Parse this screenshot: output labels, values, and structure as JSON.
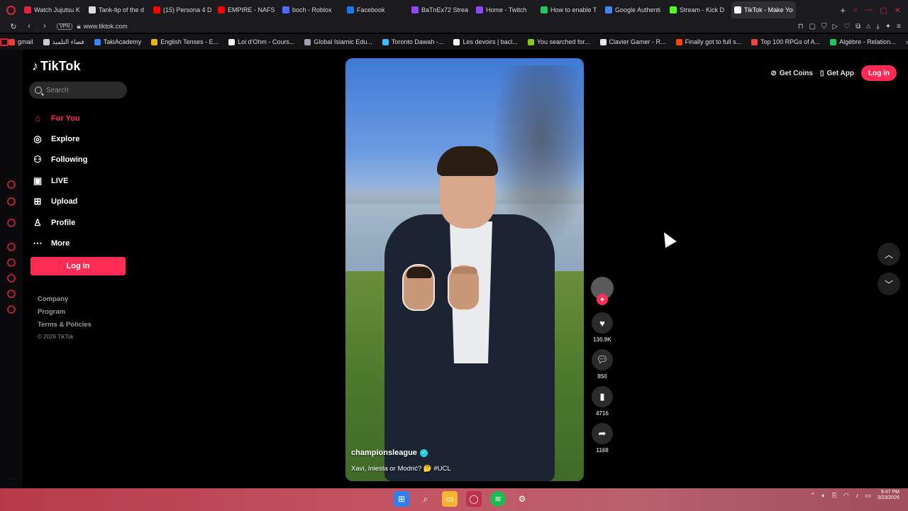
{
  "browser": {
    "tabs": [
      {
        "label": "Watch Jujutsu K",
        "color": "#e0223c"
      },
      {
        "label": "Tank-tip of the d",
        "color": "#dddddd"
      },
      {
        "label": "(15) Persona 4 D",
        "color": "#ff0000"
      },
      {
        "label": "EMPIRE - NAFS",
        "color": "#ff0000"
      },
      {
        "label": "boch - Roblox",
        "color": "#4a6cff"
      },
      {
        "label": "Facebook",
        "color": "#1877f2"
      },
      {
        "label": "BaTnEx72 Strea",
        "color": "#9146ff"
      },
      {
        "label": "Home - Twitch",
        "color": "#9146ff"
      },
      {
        "label": "How to enable T",
        "color": "#22c55e"
      },
      {
        "label": "Google Authenti",
        "color": "#4285f4"
      },
      {
        "label": "Stream - Kick D",
        "color": "#53fc18"
      },
      {
        "label": "TikTok - Make Your Da",
        "color": "#ffffff"
      }
    ],
    "active_tab_index": 11,
    "new_tab": "+",
    "url": "www.tiktok.com",
    "vpn": "VPN",
    "bookmarks": [
      {
        "label": "gmail",
        "color": "#ea4335"
      },
      {
        "label": "فضاء التلميذ",
        "color": "#cccccc"
      },
      {
        "label": "TakiAcademy",
        "color": "#3b82f6"
      },
      {
        "label": "English Tenses - E...",
        "color": "#eab308"
      },
      {
        "label": "Loi d'Ohm - Cours...",
        "color": "#f5f5f5"
      },
      {
        "label": "Global Islamic Edu...",
        "color": "#9ca3af"
      },
      {
        "label": "Toronto Dawah -...",
        "color": "#38bdf8"
      },
      {
        "label": "Les devoirs | bacl...",
        "color": "#f5f5f5"
      },
      {
        "label": "You searched for...",
        "color": "#84cc16"
      },
      {
        "label": "Clavier Gamer - R...",
        "color": "#e5e7eb"
      },
      {
        "label": "Finally got to full s...",
        "color": "#ff4500"
      },
      {
        "label": "Top 100 RPGs of A...",
        "color": "#ef4444"
      },
      {
        "label": "Algèbre - Relation...",
        "color": "#22c55e"
      }
    ]
  },
  "tiktok": {
    "logo": "TikTok",
    "search_placeholder": "Search",
    "nav": [
      {
        "label": "For You",
        "icon": "home-icon",
        "active": true
      },
      {
        "label": "Explore",
        "icon": "compass-icon",
        "active": false
      },
      {
        "label": "Following",
        "icon": "following-icon",
        "active": false
      },
      {
        "label": "LIVE",
        "icon": "live-icon",
        "active": false
      },
      {
        "label": "Upload",
        "icon": "upload-icon",
        "active": false
      },
      {
        "label": "Profile",
        "icon": "profile-icon",
        "active": false
      },
      {
        "label": "More",
        "icon": "more-icon",
        "active": false
      }
    ],
    "login_side": "Log in",
    "footer": {
      "company": "Company",
      "program": "Program",
      "terms": "Terms & Policies",
      "copyright": "© 2026 TikTok"
    },
    "top_right": {
      "get_coins": "Get Coins",
      "get_app": "Get App",
      "login": "Log in"
    },
    "video": {
      "author": "championsleague",
      "caption": "Xavi, Iniesta or Modrić? 🤔 #UCL"
    },
    "actions": {
      "likes": "130.9K",
      "comments": "850",
      "saves": "4716",
      "shares": "1168"
    },
    "accent": "#fe2c55"
  },
  "taskbar": {
    "time": "9:47 PM",
    "date": "3/23/2026"
  }
}
